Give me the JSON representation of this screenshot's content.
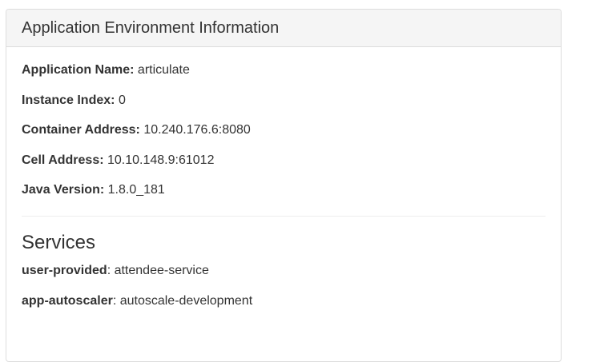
{
  "panel": {
    "title": "Application Environment Information",
    "info": [
      {
        "label": "Application Name:",
        "value": "articulate"
      },
      {
        "label": "Instance Index:",
        "value": "0"
      },
      {
        "label": "Container Address:",
        "value": "10.240.176.6:8080"
      },
      {
        "label": "Cell Address:",
        "value": "10.10.148.9:61012"
      },
      {
        "label": "Java Version:",
        "value": "1.8.0_181"
      }
    ],
    "services_heading": "Services",
    "services": [
      {
        "label": "user-provided",
        "value": "attendee-service"
      },
      {
        "label": "app-autoscaler",
        "value": "autoscale-development"
      }
    ]
  }
}
